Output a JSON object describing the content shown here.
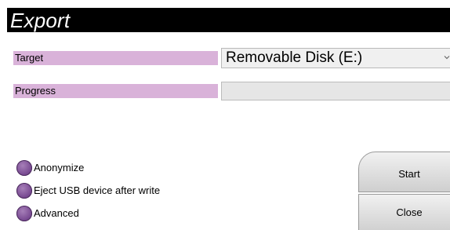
{
  "dialog": {
    "title": "Export"
  },
  "target": {
    "label": "Target",
    "selected": "Removable Disk (E:)"
  },
  "progress": {
    "label": "Progress",
    "percent": 0
  },
  "options": [
    {
      "label": "Anonymize"
    },
    {
      "label": "Eject USB device after write"
    },
    {
      "label": "Advanced"
    }
  ],
  "buttons": {
    "start_label": "Start",
    "close_label": "Close"
  },
  "colors": {
    "title_bar": "#000000",
    "label_background": "#d9b2d9",
    "radio": "#7b4d94"
  }
}
